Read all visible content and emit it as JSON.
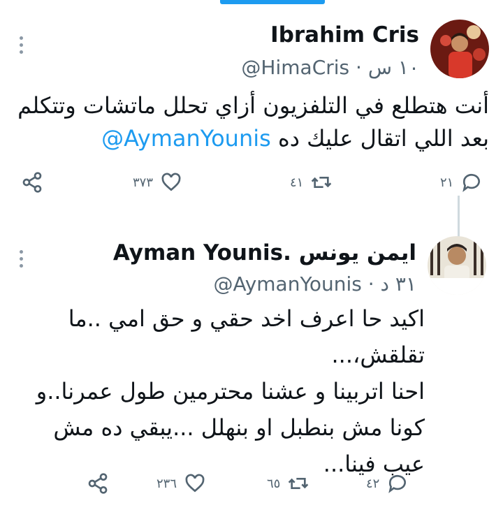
{
  "tweets": [
    {
      "display_name": "Ibrahim Cris",
      "meta": "@HimaCris · ١٠ س",
      "text_line1": "أنت هتطلع في التلفزيون أزاي تحلل ماتشات وتتكلم",
      "text_line2_before": "بعد اللي اتقال عليك ده",
      "mention": "@AymanYounis",
      "replies": "٢١",
      "retweets": "٤١",
      "likes": "٣٧٣"
    },
    {
      "display_name": "Ayman Younis. ايمن يونس",
      "meta": "@AymanYounis · ٣١ د",
      "text_lines": [
        "اكيد حا اعرف اخد حقي و حق امي ..ما",
        "تقلقش،...",
        "احنا اتربينا و عشنا محترمين طول عمرنا..و",
        "كونا مش بنطبل او بنهلل ...يبقي ده مش",
        "عيب فينا..."
      ],
      "replies": "٤٢",
      "retweets": "٦٥",
      "likes": "٢٣٦"
    }
  ],
  "icons": {
    "reply": "reply-icon",
    "retweet": "retweet-icon",
    "like": "heart-icon",
    "share": "share-icon",
    "more": "more-vertical-icon"
  },
  "colors": {
    "accent": "#1d9bf0",
    "muted": "#536471",
    "text": "#0f1419"
  }
}
